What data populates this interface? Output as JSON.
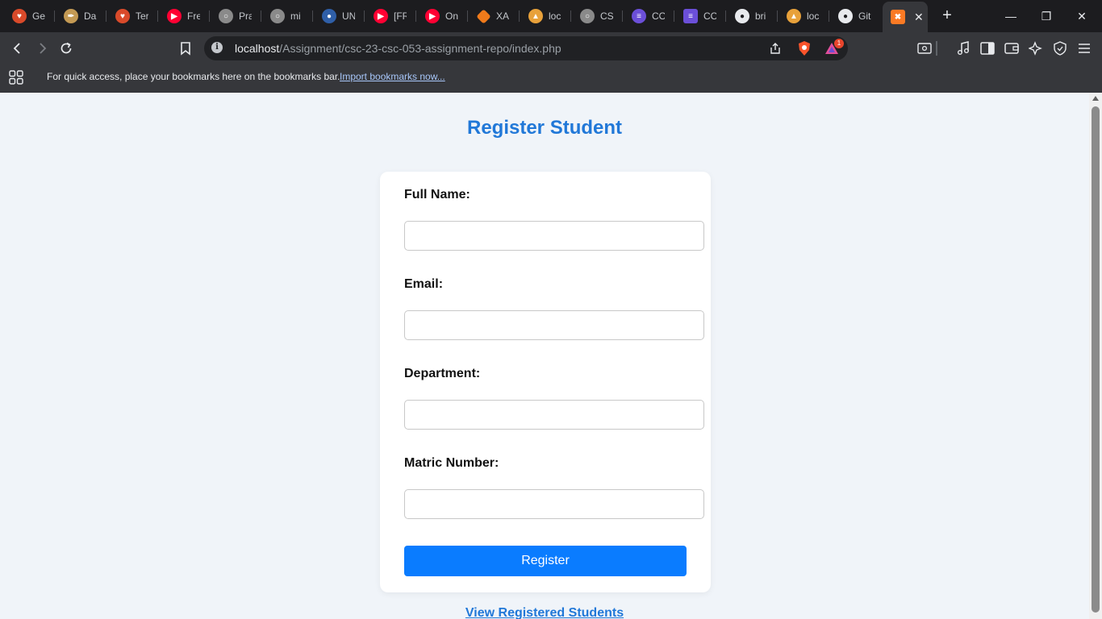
{
  "browser": {
    "tabs": [
      {
        "title": "Ge",
        "icon": "brave-lion-icon",
        "color": "#d94a2a"
      },
      {
        "title": "Da",
        "icon": "pen-nib-icon",
        "color": "#c49a54"
      },
      {
        "title": "Ter",
        "icon": "brave-lion-icon",
        "color": "#d94a2a"
      },
      {
        "title": "Fre",
        "icon": "youtube-icon",
        "color": "#ff0033"
      },
      {
        "title": "Pra",
        "icon": "globe-icon",
        "color": "#8a8a8a"
      },
      {
        "title": "mi",
        "icon": "globe-icon",
        "color": "#8a8a8a"
      },
      {
        "title": "UN",
        "icon": "university-seal-icon",
        "color": "#2f5fa8"
      },
      {
        "title": "[FR",
        "icon": "youtube-icon",
        "color": "#ff0033"
      },
      {
        "title": "On",
        "icon": "youtube-icon",
        "color": "#ff0033"
      },
      {
        "title": "XA",
        "icon": "xampp-diamond-icon",
        "color": "#f07a1a"
      },
      {
        "title": "loc",
        "icon": "phpmyadmin-sail-icon",
        "color": "#e8a13a"
      },
      {
        "title": "CS",
        "icon": "globe-icon",
        "color": "#8a8a8a"
      },
      {
        "title": "CO",
        "icon": "list-doc-icon",
        "color": "#6b4fd8"
      },
      {
        "title": "CO",
        "icon": "list-doc-icon",
        "color": "#6b4fd8"
      },
      {
        "title": "bri",
        "icon": "github-icon",
        "color": "#e8eaed"
      },
      {
        "title": "loc",
        "icon": "phpmyadmin-sail-icon",
        "color": "#e8a13a"
      },
      {
        "title": "Git",
        "icon": "github-icon",
        "color": "#e8eaed"
      }
    ],
    "active_tab": {
      "icon": "xampp-icon",
      "color": "#fb7a24"
    },
    "url": {
      "host": "localhost",
      "path": "/Assignment/csc-23-csc-053-assignment-repo/index.php"
    },
    "rewards_badge": "1",
    "bookmarks_bar": {
      "message": "For quick access, place your bookmarks here on the bookmarks bar.",
      "import_link": "Import bookmarks now..."
    }
  },
  "page": {
    "title": "Register Student",
    "form": {
      "fields": [
        {
          "label": "Full Name:",
          "value": "",
          "placeholder": ""
        },
        {
          "label": "Email:",
          "value": "",
          "placeholder": ""
        },
        {
          "label": "Department:",
          "value": "",
          "placeholder": ""
        },
        {
          "label": "Matric Number:",
          "value": "",
          "placeholder": ""
        }
      ],
      "submit_label": "Register"
    },
    "view_link": "View Registered Students",
    "colors": {
      "accent": "#2178d8",
      "button": "#0a7cff",
      "background": "#f0f4f9"
    }
  }
}
